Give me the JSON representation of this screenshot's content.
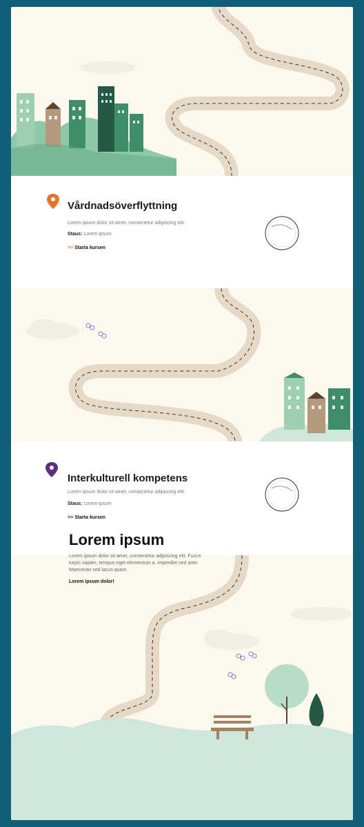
{
  "courses": [
    {
      "title": "Vårdnadsöverflyttning",
      "description": "Lorem ipsum dolor sit amet, consectetur adipiscing elit.",
      "status_label": "Staus:",
      "status_value": "Lorem ipsum",
      "cta": "Starta kursen",
      "pin_color": "#e6732b"
    },
    {
      "title": "Interkulturell kompetens",
      "description": "Lorem ipsum dolor sit amet, consectetur adipiscing elit.",
      "status_label": "Staus:",
      "status_value": "Lorem ipsum",
      "cta": "Starta kursen",
      "pin_color": "#5b2f7c"
    }
  ],
  "hero": {
    "title": "Lorem ipsum",
    "text": "Lorem ipsum dolor sit amet, consectetur adipiscing elit. Fusce turpis sapien, tempus eget elementum a, imperdiet sed ante. Maecenas sed lacus quam.",
    "link": "Lorem ipsum dolor!"
  },
  "icons": {
    "pin": "location-pin-icon",
    "chevron": "double-chevron-right-icon",
    "stamp": "postmark-stamp-icon"
  },
  "colors": {
    "background": "#fbf8ef",
    "frame": "#0f5d77",
    "road": "#e6d9c6",
    "hills": "#cfe6da",
    "building_green": "#3f8d6b",
    "building_dark": "#245a45",
    "building_brown": "#b39a7e",
    "accent_orange": "#e6732b",
    "accent_purple": "#5b2f7c"
  }
}
